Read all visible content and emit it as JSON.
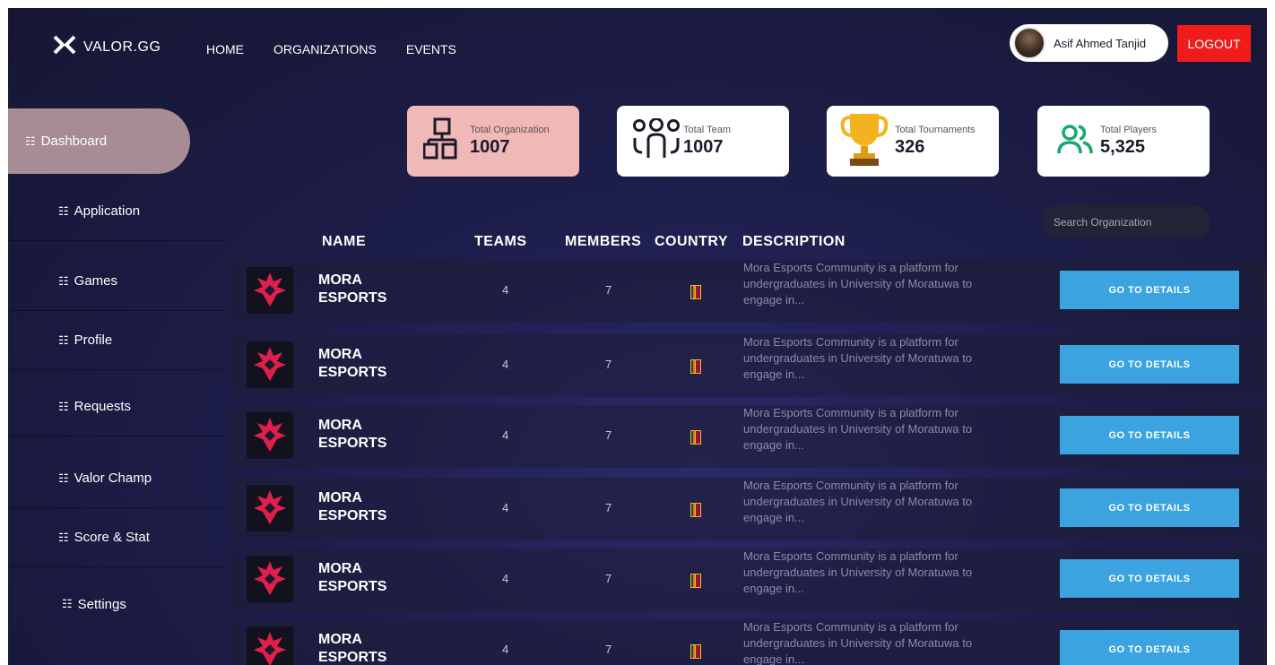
{
  "nav": {
    "brand": "VALOR.GG",
    "links": [
      "HOME",
      "ORGANIZATIONS",
      "EVENTS"
    ],
    "user_name": "Asif Ahmed Tanjid",
    "logout_label": "LOGOUT"
  },
  "sidebar": {
    "items": [
      {
        "label": "Dashboard",
        "icon": "grid-icon",
        "active": true
      },
      {
        "label": "Application",
        "icon": "grid-icon"
      },
      {
        "label": "Games",
        "icon": "grid-icon"
      },
      {
        "label": "Profile",
        "icon": "grid-icon"
      },
      {
        "label": "Requests",
        "icon": "grid-icon"
      },
      {
        "label": "Valor Champ",
        "icon": "grid-icon"
      },
      {
        "label": "Score & Stat",
        "icon": "grid-icon"
      },
      {
        "label": "Settings",
        "icon": "grid-icon"
      }
    ]
  },
  "stats": [
    {
      "label": "Total Organization",
      "value": "1007",
      "icon": "hierarchy-icon"
    },
    {
      "label": "Total Team",
      "value": "1007",
      "icon": "team-icon"
    },
    {
      "label": "Total Tournaments",
      "value": "326",
      "icon": "trophy-icon"
    },
    {
      "label": "Total Players",
      "value": "5,325",
      "icon": "players-icon"
    }
  ],
  "search": {
    "placeholder": "Search Organization"
  },
  "table": {
    "headers": [
      "NAME",
      "TEAMS",
      "MEMBERS",
      "COUNTRY",
      "DESCRIPTION"
    ],
    "rows": [
      {
        "name_line1": "MORA",
        "name_line2": "ESPORTS",
        "teams": "4",
        "members": "7",
        "description": "Mora Esports Community is a platform for undergraduates in University of Moratuwa to engage in...",
        "action": "GO TO DETAILS"
      },
      {
        "name_line1": "MORA",
        "name_line2": "ESPORTS",
        "teams": "4",
        "members": "7",
        "description": "Mora Esports Community is a platform for undergraduates in University of Moratuwa to engage in...",
        "action": "GO TO DETAILS"
      },
      {
        "name_line1": "MORA",
        "name_line2": "ESPORTS",
        "teams": "4",
        "members": "7",
        "description": "Mora Esports Community is a platform for undergraduates in University of Moratuwa to engage in...",
        "action": "GO TO DETAILS"
      },
      {
        "name_line1": "MORA",
        "name_line2": "ESPORTS",
        "teams": "4",
        "members": "7",
        "description": "Mora Esports Community is a platform for undergraduates in University of Moratuwa to engage in...",
        "action": "GO TO DETAILS"
      },
      {
        "name_line1": "MORA",
        "name_line2": "ESPORTS",
        "teams": "4",
        "members": "7",
        "description": "Mora Esports Community is a platform for undergraduates in University of Moratuwa to engage in...",
        "action": "GO TO DETAILS"
      },
      {
        "name_line1": "MORA",
        "name_line2": "ESPORTS",
        "teams": "4",
        "members": "7",
        "description": "Mora Esports Community is a platform for undergraduates in University of Moratuwa to engage in...",
        "action": "GO TO DETAILS"
      }
    ]
  },
  "colors": {
    "background": "#1d1d4a",
    "active_sidebar": "#a78c93",
    "logout": "#f01c1c",
    "details_button": "#3aa3e0",
    "org_card": "#f1b8b8"
  }
}
